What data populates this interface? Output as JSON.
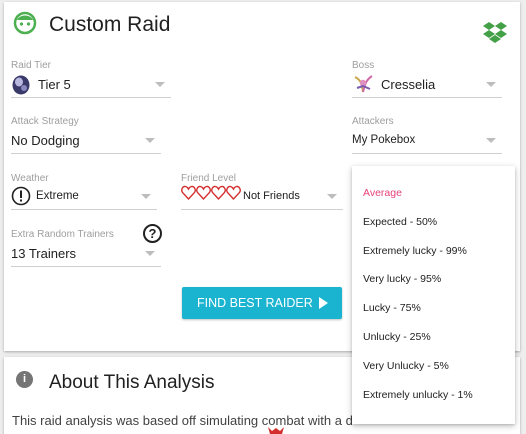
{
  "header": {
    "title": "Custom Raid"
  },
  "raid_tier": {
    "label": "Raid Tier",
    "value": "Tier 5"
  },
  "boss": {
    "label": "Boss",
    "value": "Cresselia"
  },
  "attack_strategy": {
    "label": "Attack Strategy",
    "value": "No Dodging"
  },
  "attackers": {
    "label": "Attackers",
    "value": "My Pokebox"
  },
  "weather": {
    "label": "Weather",
    "value": "Extreme"
  },
  "friend_level": {
    "label": "Friend Level",
    "value": "Not Friends"
  },
  "extra_trainers": {
    "label": "Extra Random Trainers",
    "value": "13 Trainers",
    "help": "?"
  },
  "find_button": {
    "label": "FIND BEST RAIDER"
  },
  "about": {
    "title": "About This Analysis",
    "text": "This raid analysis was based off simulating combat with a d",
    "info": "i"
  },
  "luck_dropdown": {
    "items": [
      "Average",
      "Expected - 50%",
      "Extremely lucky - 99%",
      "Very lucky - 95%",
      "Lucky - 75%",
      "Unlucky - 25%",
      "Very Unlucky - 5%",
      "Extremely unlucky - 1%"
    ],
    "selected": "Average"
  },
  "colors": {
    "accent": "#1ab4d1",
    "selected": "#e5407a",
    "hearts": "#d32f2f",
    "logo": "#4caf50",
    "dropbox": "#43a047"
  }
}
